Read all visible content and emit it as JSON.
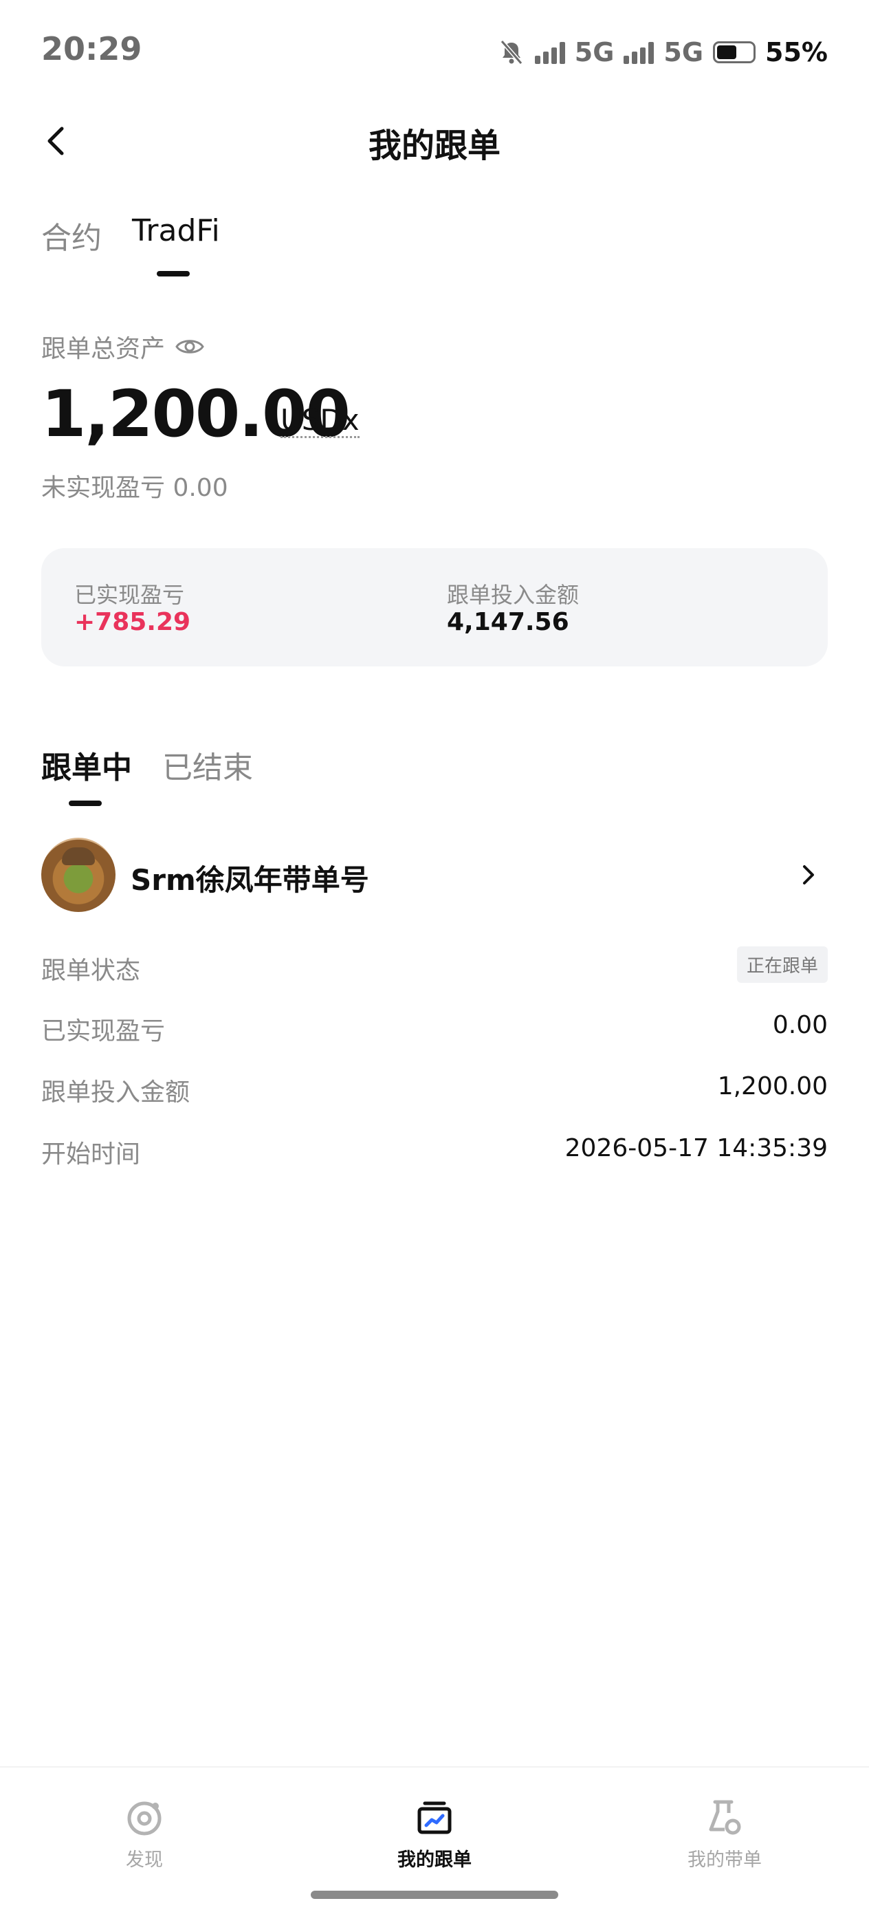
{
  "status_bar": {
    "time": "20:29",
    "network1": "5G",
    "network2": "5G",
    "battery": "55%"
  },
  "header": {
    "title": "我的跟单"
  },
  "top_tabs": [
    {
      "label": "合约",
      "active": false
    },
    {
      "label": "TradFi",
      "active": true
    }
  ],
  "assets": {
    "label": "跟单总资产",
    "value": "1,200.00",
    "unit": "USDx",
    "unrealized": "未实现盈亏 0.00"
  },
  "summary": {
    "realized_label": "已实现盈亏",
    "realized_value": "+785.29",
    "invest_label": "跟单投入金额",
    "invest_value": "4,147.56"
  },
  "list_tabs": [
    {
      "label": "跟单中",
      "active": true
    },
    {
      "label": "已结束",
      "active": false
    }
  ],
  "trader": {
    "name": "Srm徐凤年带单号",
    "rows": [
      {
        "label": "跟单状态",
        "value": "正在跟单"
      },
      {
        "label": "已实现盈亏",
        "value": "0.00"
      },
      {
        "label": "跟单投入金额",
        "value": "1,200.00"
      },
      {
        "label": "开始时间",
        "value": "2026-05-17 14:35:39"
      }
    ]
  },
  "bottom_nav": [
    {
      "label": "发现",
      "icon": "target-icon",
      "active": false
    },
    {
      "label": "我的跟单",
      "icon": "chart-box-icon",
      "active": true
    },
    {
      "label": "我的带单",
      "icon": "flask-icon",
      "active": false
    }
  ],
  "colors": {
    "positive": "#e9335b",
    "accent_icon": "#2f6bff"
  }
}
